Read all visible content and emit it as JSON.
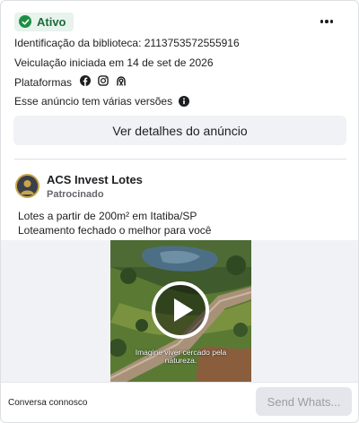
{
  "status": {
    "label": "Ativo",
    "color": "#1d8f45"
  },
  "library_id": "Identificação da biblioteca: 2113753572555916",
  "started": "Veiculação iniciada em 14 de set de 2026",
  "platforms": {
    "label": "Plataformas",
    "icons": [
      "facebook-icon",
      "instagram-icon",
      "audience-network-icon"
    ]
  },
  "versions_note": "Esse anúncio tem várias versões",
  "details_button": "Ver detalhes do anúncio",
  "advertiser": {
    "name": "ACS Invest Lotes",
    "sponsored": "Patrocinado"
  },
  "ad_body": [
    "Lotes a partir de 200m² em Itatiba/SP",
    "Loteamento fechado o melhor para você"
  ],
  "video": {
    "caption": [
      "Imagine viver cercado pela",
      "natureza."
    ]
  },
  "footer": {
    "text": "Conversa connosco",
    "cta": "Send Whats..."
  }
}
